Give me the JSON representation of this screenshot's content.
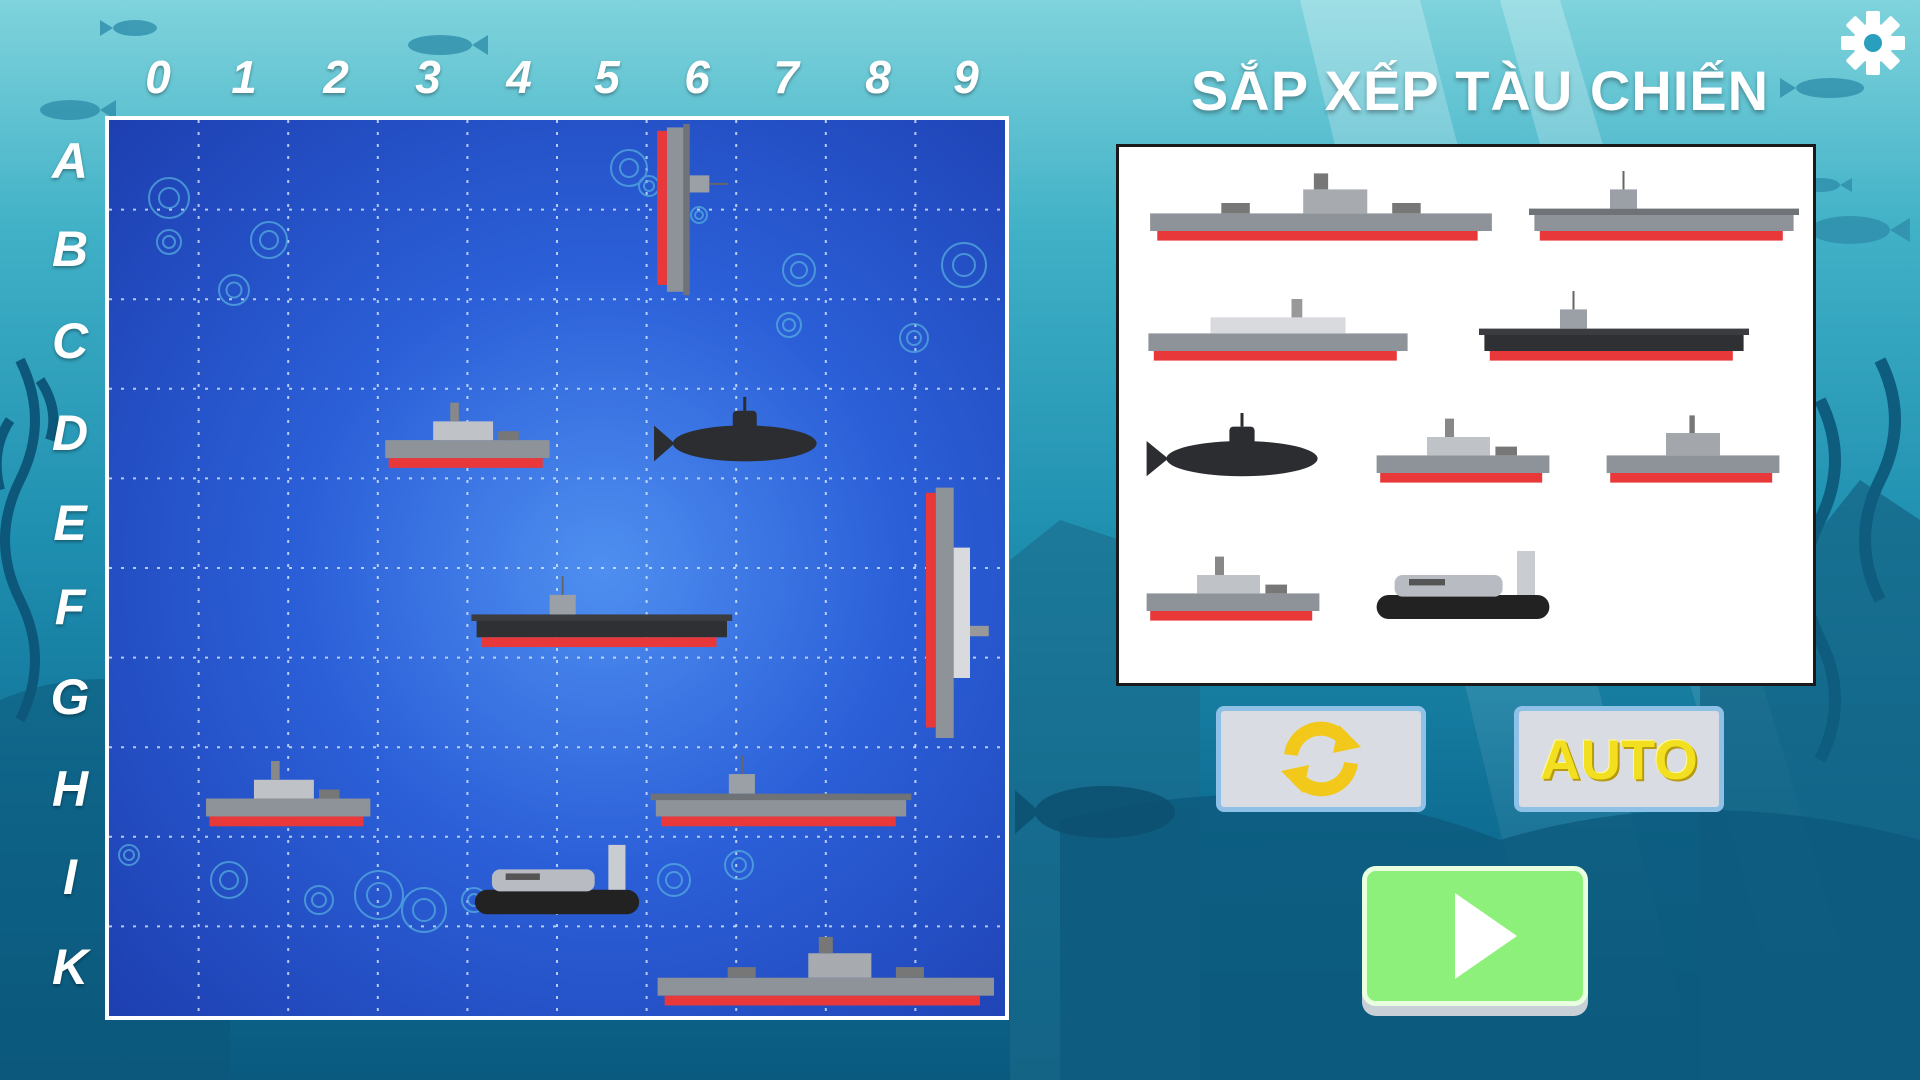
{
  "title": "SẮP XẾP TÀU CHIẾN",
  "columns": [
    "0",
    "1",
    "2",
    "3",
    "4",
    "5",
    "6",
    "7",
    "8",
    "9"
  ],
  "rows": [
    "A",
    "B",
    "C",
    "D",
    "E",
    "F",
    "G",
    "H",
    "I",
    "K"
  ],
  "buttons": {
    "refresh": "refresh-icon",
    "auto": "AUTO",
    "play": "play-icon"
  },
  "settings_icon": "gear-icon",
  "board_ships": [
    {
      "id": "carrier-vertical-col6",
      "type": "aircraft-carrier",
      "cells": [
        "A6",
        "B6"
      ],
      "orientation": "vertical"
    },
    {
      "id": "frigate-d3",
      "type": "frigate",
      "cells": [
        "D3",
        "D4"
      ],
      "orientation": "horizontal"
    },
    {
      "id": "submarine-d6",
      "type": "submarine",
      "cells": [
        "D6",
        "D7"
      ],
      "orientation": "horizontal"
    },
    {
      "id": "destroyer-vertical-col9",
      "type": "destroyer",
      "cells": [
        "E9",
        "F9",
        "G9"
      ],
      "orientation": "vertical"
    },
    {
      "id": "dark-carrier-f4",
      "type": "dark-carrier",
      "cells": [
        "F4",
        "F5",
        "F6"
      ],
      "orientation": "horizontal"
    },
    {
      "id": "patrol-boat-h1",
      "type": "patrol-boat",
      "cells": [
        "H1",
        "H2"
      ],
      "orientation": "horizontal"
    },
    {
      "id": "carrier-h6",
      "type": "aircraft-carrier",
      "cells": [
        "H6",
        "H7",
        "H8"
      ],
      "orientation": "horizontal"
    },
    {
      "id": "hovercraft-i4",
      "type": "hovercraft",
      "cells": [
        "I4",
        "I5"
      ],
      "orientation": "horizontal"
    },
    {
      "id": "battleship-k6",
      "type": "battleship",
      "cells": [
        "K6",
        "K7",
        "K8",
        "K9"
      ],
      "orientation": "horizontal"
    }
  ],
  "fleet_panel": [
    "battleship",
    "aircraft-carrier",
    "destroyer",
    "dark-carrier",
    "submarine",
    "patrol-boat",
    "cruiser",
    "frigate",
    "hovercraft"
  ],
  "colors": {
    "hull_red": "#e8383a",
    "hull_gray": "#8e9399",
    "board_blue": "#2b5fd8",
    "auto_yellow": "#f2e020",
    "play_green": "#8df07a"
  }
}
